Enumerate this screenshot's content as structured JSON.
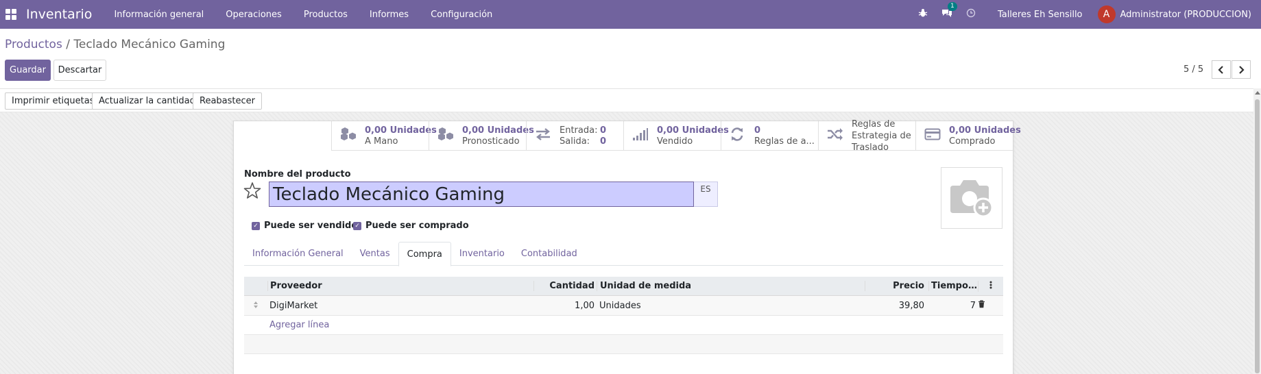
{
  "navbar": {
    "app_name": "Inventario",
    "menu": [
      "Información general",
      "Operaciones",
      "Productos",
      "Informes",
      "Configuración"
    ],
    "messages_count": "1",
    "company": "Talleres Eh Sensillo",
    "user_initial": "A",
    "user_name": "Administrator (PRODUCCION)",
    "accent_color": "#71639e"
  },
  "breadcrumb": {
    "parent": "Productos",
    "separator": " / ",
    "current": "Teclado Mecánico Gaming"
  },
  "control": {
    "save": "Guardar",
    "discard": "Descartar",
    "pager": "5 / 5"
  },
  "actions": {
    "print_labels": "Imprimir etiquetas",
    "update_qty": "Actualizar la cantidad",
    "replenish": "Reabastecer"
  },
  "smart_buttons": {
    "on_hand": {
      "value": "0,00 Unidades",
      "label": "A Mano"
    },
    "forecast": {
      "value": "0,00 Unidades",
      "label": "Pronosticado"
    },
    "moves": {
      "in_label": "Entrada:",
      "in_value": "0",
      "out_label": "Salida:",
      "out_value": "0"
    },
    "sold": {
      "value": "0,00 Unidades",
      "label": "Vendido"
    },
    "rules": {
      "value": "0",
      "label": "Reglas de a..."
    },
    "putaway": {
      "label": "Reglas de Estrategia de Traslado"
    },
    "purchased": {
      "value": "0,00 Unidades",
      "label": "Comprado"
    }
  },
  "form": {
    "name_label": "Nombre del producto",
    "name_value": "Teclado Mecánico Gaming",
    "lang": "ES",
    "can_be_sold": "Puede ser vendido",
    "can_be_purchased": "Puede ser comprado"
  },
  "tabs": [
    "Información General",
    "Ventas",
    "Compra",
    "Inventario",
    "Contabilidad"
  ],
  "active_tab": "Compra",
  "supplier_table": {
    "headers": {
      "vendor": "Proveedor",
      "qty": "Cantidad",
      "uom": "Unidad de medida",
      "price": "Precio",
      "lead": "Tiempo ..."
    },
    "rows": [
      {
        "vendor": "DigiMarket",
        "qty": "1,00",
        "uom": "Unidades",
        "price": "39,80",
        "lead": "7"
      }
    ],
    "add_line": "Agregar línea"
  }
}
